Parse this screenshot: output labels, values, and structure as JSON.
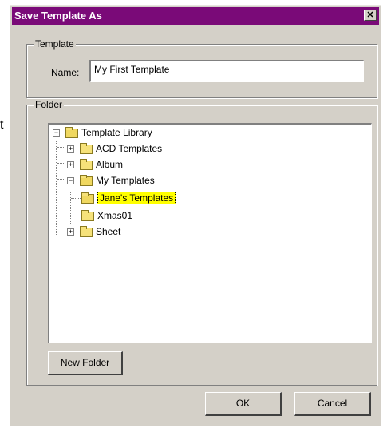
{
  "outside": {
    "stray_char": "t"
  },
  "window": {
    "title": "Save Template As",
    "close_glyph": "✕"
  },
  "template_group": {
    "label": "Template",
    "name_label": "Name:",
    "name_value": "My First Template"
  },
  "folder_group": {
    "label": "Folder",
    "tree": [
      {
        "label": "Template Library",
        "expander": "−",
        "open": true
      },
      {
        "label": "ACD Templates",
        "expander": "+",
        "open": false
      },
      {
        "label": "Album",
        "expander": "+",
        "open": false
      },
      {
        "label": "My Templates",
        "expander": "−",
        "open": true
      },
      {
        "label": "Jane's Templates",
        "selected": true,
        "open": true
      },
      {
        "label": "Xmas01",
        "open": false
      },
      {
        "label": "Sheet",
        "expander": "+",
        "open": false
      }
    ],
    "new_folder_label": "New Folder"
  },
  "buttons": {
    "ok_label": "OK",
    "cancel_label": "Cancel"
  },
  "colors": {
    "titlebar": "#7a0a78",
    "selection": "#ffff00",
    "face": "#d4d0c8"
  }
}
